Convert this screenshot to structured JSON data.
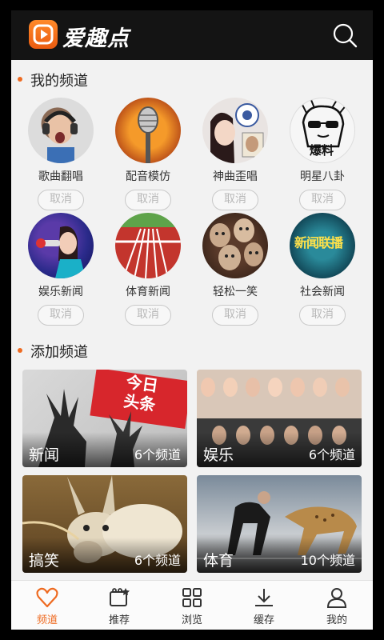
{
  "app": {
    "title": "爱趣点"
  },
  "header": {
    "search_icon": "search-icon",
    "logo_icon": "play-logo-icon"
  },
  "my_channels": {
    "title": "我的频道",
    "items": [
      {
        "label": "歌曲翻唱",
        "action": "取消"
      },
      {
        "label": "配音模仿",
        "action": "取消"
      },
      {
        "label": "神曲歪唱",
        "action": "取消"
      },
      {
        "label": "明星八卦",
        "action": "取消",
        "thumb_text": "爆料"
      },
      {
        "label": "娱乐新闻",
        "action": "取消"
      },
      {
        "label": "体育新闻",
        "action": "取消"
      },
      {
        "label": "轻松一笑",
        "action": "取消"
      },
      {
        "label": "社会新闻",
        "action": "取消",
        "thumb_text": "新闻联播"
      }
    ]
  },
  "add_channels": {
    "title": "添加频道",
    "cards": [
      {
        "name": "新闻",
        "count": "6个频道",
        "thumb_text": "今日头条"
      },
      {
        "name": "娱乐",
        "count": "6个频道"
      },
      {
        "name": "搞笑",
        "count": "6个频道"
      },
      {
        "name": "体育",
        "count": "10个频道"
      }
    ]
  },
  "bottom_nav": {
    "items": [
      {
        "label": "频道",
        "icon": "heart-icon",
        "active": true
      },
      {
        "label": "推荐",
        "icon": "recommend-icon"
      },
      {
        "label": "浏览",
        "icon": "grid-icon"
      },
      {
        "label": "缓存",
        "icon": "download-icon"
      },
      {
        "label": "我的",
        "icon": "user-icon"
      }
    ]
  },
  "colors": {
    "accent": "#ee6a20",
    "header_bg": "#141414"
  }
}
